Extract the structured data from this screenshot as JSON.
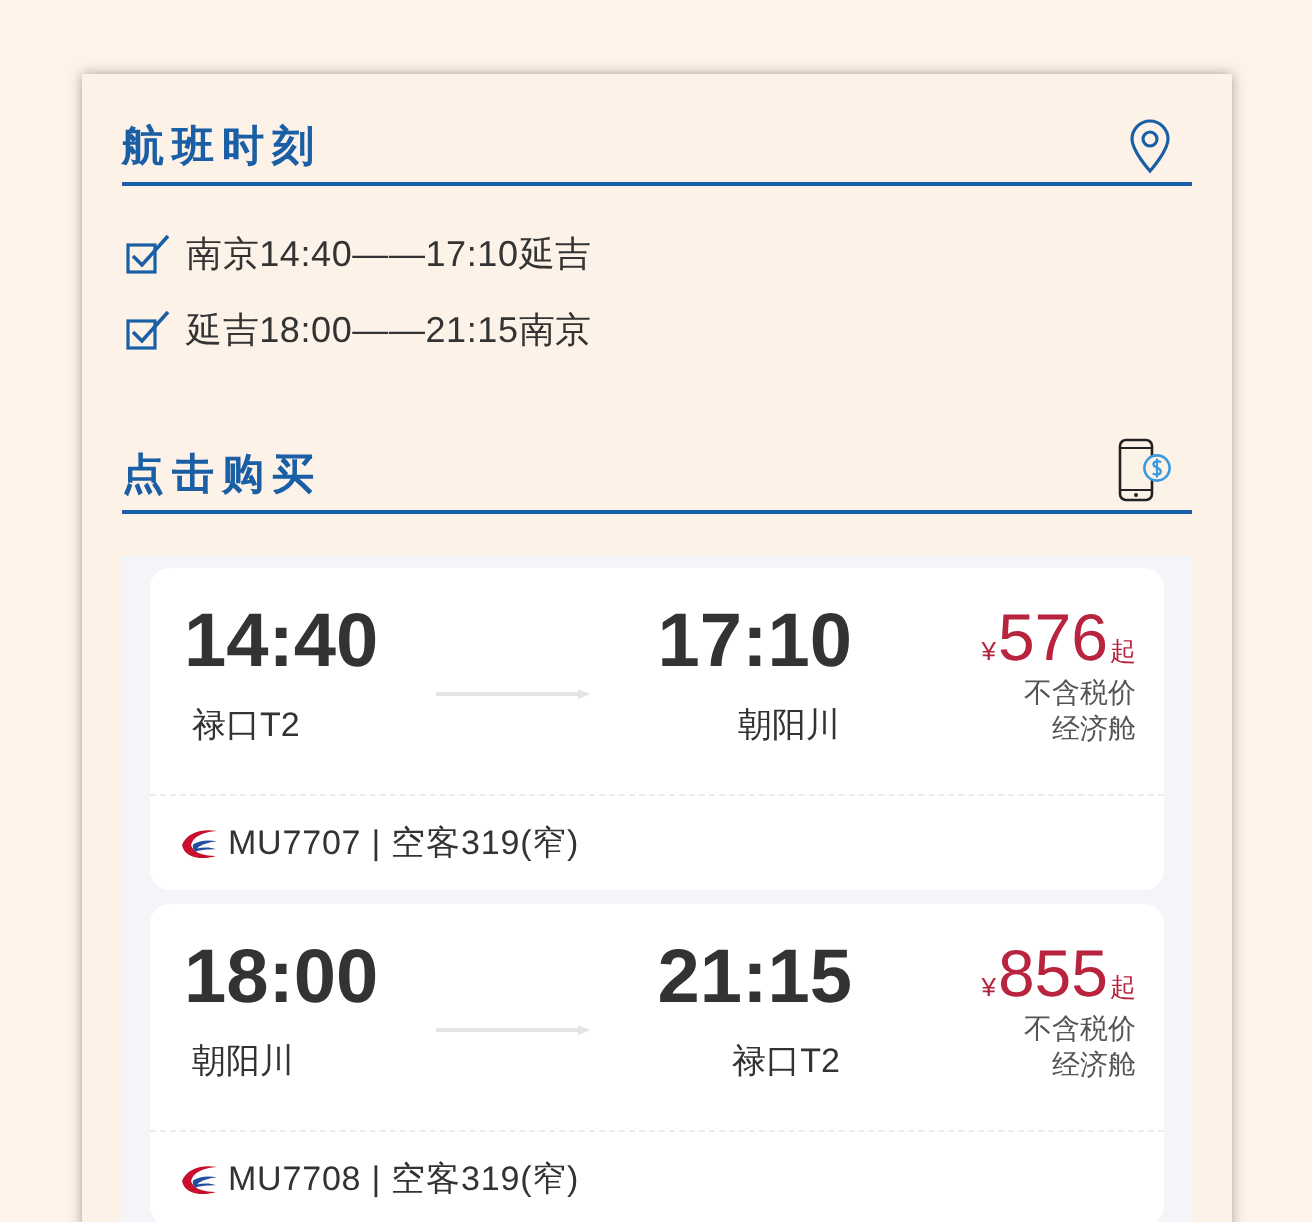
{
  "schedule": {
    "title": "航班时刻",
    "items": [
      {
        "text": "南京14:40——17:10延吉",
        "checked": true
      },
      {
        "text": "延吉18:00——21:15南京",
        "checked": true
      }
    ]
  },
  "purchase": {
    "title": "点击购买",
    "flights": [
      {
        "depart_time": "14:40",
        "depart_airport": "禄口T2",
        "arrive_time": "17:10",
        "arrive_airport": "朝阳川",
        "currency": "¥",
        "price": "576",
        "price_suffix": "起",
        "tax_note": "不含税价",
        "cabin": "经济舱",
        "flight_info": "MU7707 | 空客319(窄)"
      },
      {
        "depart_time": "18:00",
        "depart_airport": "朝阳川",
        "arrive_time": "21:15",
        "arrive_airport": "禄口T2",
        "currency": "¥",
        "price": "855",
        "price_suffix": "起",
        "tax_note": "不含税价",
        "cabin": "经济舱",
        "flight_info": "MU7708 | 空客319(窄)"
      }
    ]
  }
}
